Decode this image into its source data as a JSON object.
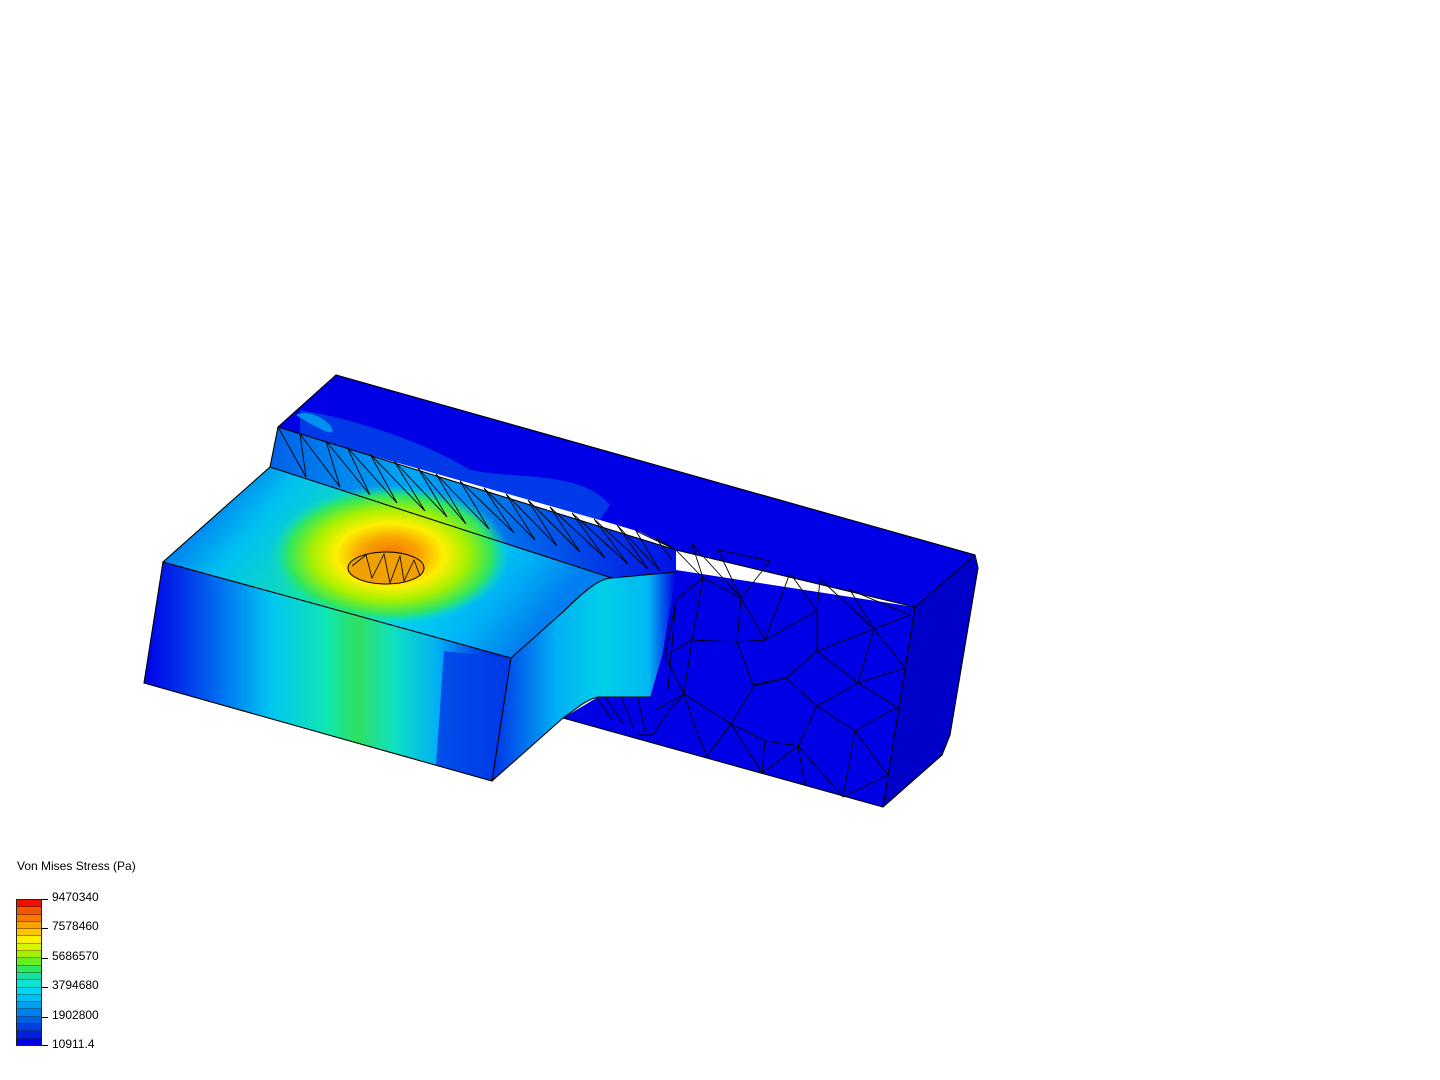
{
  "legend": {
    "title": "Von Mises Stress (Pa)",
    "labels": [
      "9470340",
      "7578460",
      "5686570",
      "3794680",
      "1902800",
      "10911.4"
    ],
    "palette": [
      "#ee1100",
      "#f45500",
      "#f77a00",
      "#f9a200",
      "#fbc800",
      "#fdf000",
      "#d8f500",
      "#a6f000",
      "#69ec20",
      "#2ee660",
      "#14e0a0",
      "#0ce3d0",
      "#00d8f5",
      "#00bff5",
      "#00a0f0",
      "#0080f0",
      "#0060e8",
      "#0040e0",
      "#0020e0",
      "#0000e6"
    ]
  }
}
